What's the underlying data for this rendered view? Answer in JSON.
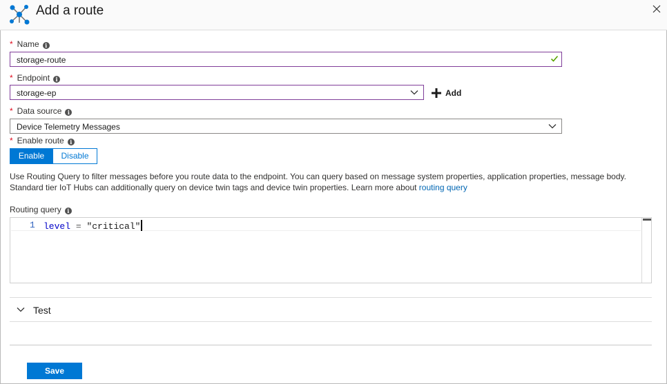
{
  "header": {
    "title": "Add a route",
    "logo_icon": "route-network-icon",
    "close_icon": "close-icon"
  },
  "form": {
    "name": {
      "label": "Name",
      "value": "storage-route",
      "valid": true
    },
    "endpoint": {
      "label": "Endpoint",
      "value": "storage-ep",
      "add_label": "Add"
    },
    "data_source": {
      "label": "Data source",
      "value": "Device Telemetry Messages"
    },
    "enable_route": {
      "label": "Enable route",
      "options": [
        "Enable",
        "Disable"
      ],
      "selected": "Enable"
    },
    "required_marker": "*",
    "info_glyph": "i"
  },
  "description": {
    "text": "Use Routing Query to filter messages before you route data to the endpoint. You can query based on message system properties, application properties, message body. Standard tier IoT Hubs can additionally query on device twin tags and device twin properties. Learn more about ",
    "link": "routing query"
  },
  "routing_query": {
    "label": "Routing query",
    "line_number": "1",
    "code_keyword": "level",
    "code_operator": "=",
    "code_string": "\"critical\""
  },
  "test_section": {
    "label": "Test"
  },
  "footer": {
    "save_label": "Save"
  },
  "colors": {
    "accent": "#0078d4",
    "focus_border": "#7f3d99",
    "required": "#e00b1c",
    "valid": "#57a300",
    "link": "#0066b3"
  }
}
